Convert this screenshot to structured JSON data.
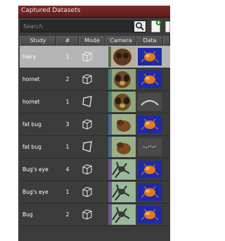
{
  "window": {
    "title": "Captured Datasets"
  },
  "search": {
    "placeholder": "Search",
    "value": ""
  },
  "columns": {
    "study": "Study",
    "number": "#",
    "mode": "Mode",
    "camera": "Camera",
    "data": "Data"
  },
  "rows": [
    {
      "study": "hairy",
      "count": "1",
      "mode": "cube",
      "camera": "bug-closeup",
      "data": "blob-on-blue",
      "selected": true
    },
    {
      "study": "hornet",
      "count": "2",
      "mode": "cube",
      "camera": "hornet-face",
      "data": "blob-on-blue",
      "selected": false
    },
    {
      "study": "hornet",
      "count": "1",
      "mode": "frustum",
      "camera": "hornet-face",
      "data": "arc-on-gray",
      "selected": false
    },
    {
      "study": "fat bug",
      "count": "3",
      "mode": "cube",
      "camera": "fat-bug",
      "data": "blob-on-blue",
      "selected": false
    },
    {
      "study": "fat bug",
      "count": "1",
      "mode": "frustum",
      "camera": "fat-bug",
      "data": "points-on-gray",
      "selected": false
    },
    {
      "study": "Bug's eye",
      "count": "4",
      "mode": "cube",
      "camera": "bug-leg",
      "data": "blob-on-blue",
      "selected": false
    },
    {
      "study": "Bug's eye",
      "count": "1",
      "mode": "cube",
      "camera": "bug-leg",
      "data": "blob-on-blue",
      "selected": false
    },
    {
      "study": "Bug",
      "count": "2",
      "mode": "cube",
      "camera": "bug-leg",
      "data": "blob-on-blue",
      "selected": false
    }
  ],
  "colors": {
    "titlebar": "#6b2424",
    "panel": "#3c3c3c",
    "selected_row": "#b5b5b5",
    "data_blue": "#1f2aa8",
    "data_orange": "#e07a1c"
  }
}
